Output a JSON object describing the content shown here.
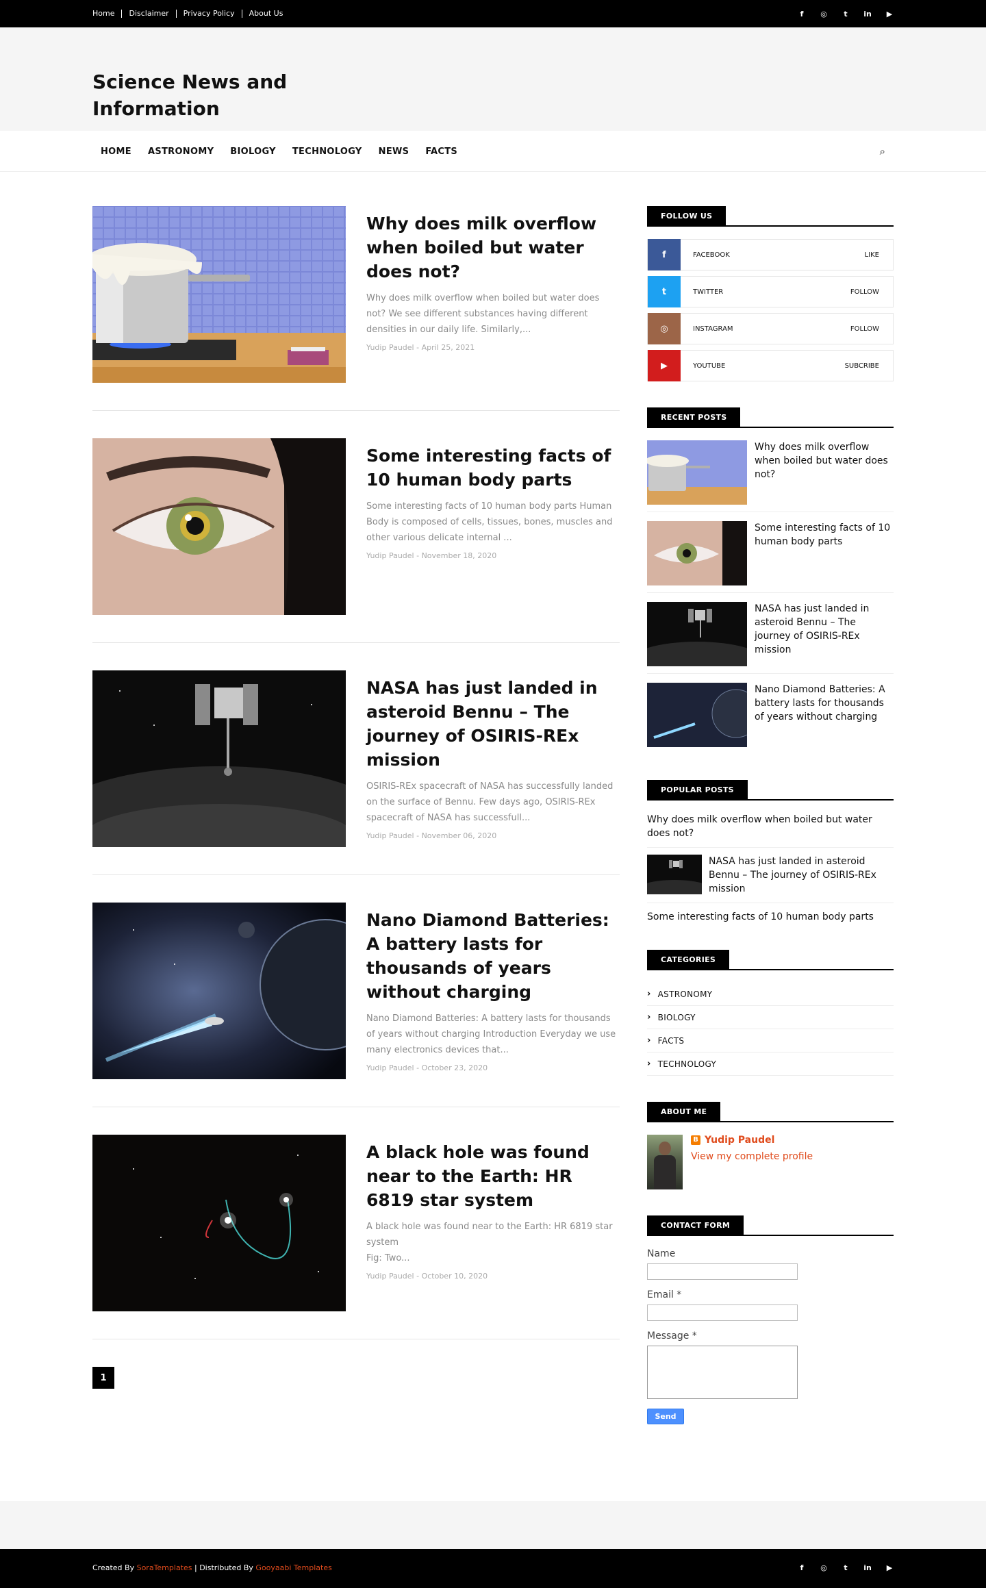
{
  "topbar": {
    "links": [
      "Home",
      "Disclaimer",
      "Privacy Policy",
      "About Us"
    ],
    "social": [
      "facebook-icon",
      "instagram-icon",
      "twitter-icon",
      "linkedin-icon",
      "youtube-icon"
    ],
    "social_glyphs": [
      "f",
      "◎",
      "t",
      "in",
      "▶"
    ]
  },
  "header": {
    "title": "Science News and Information"
  },
  "nav": {
    "items": [
      "HOME",
      "ASTRONOMY",
      "BIOLOGY",
      "TECHNOLOGY",
      "NEWS",
      "FACTS"
    ],
    "search_glyph": "⌕"
  },
  "posts": [
    {
      "title": "Why does milk overflow when boiled but water does not?",
      "snippet": "Why does milk overflow when boiled but water does not?  We see different substances having different densities in our daily life. Similarly,...",
      "meta": "Yudip Paudel - April 25, 2021"
    },
    {
      "title": "Some interesting facts of 10 human body parts",
      "snippet": " Some interesting facts of 10 human body parts Human Body is composed of cells, tissues, bones, muscles and other various delicate internal ...",
      "meta": "Yudip Paudel - November 18, 2020"
    },
    {
      "title": "NASA has just landed in asteroid Bennu – The journey of OSIRIS-REx mission",
      "snippet": "OSIRIS-REx spacecraft of NASA has successfully landed on the surface of Bennu.   Few days ago, OSIRIS-REx spacecraft of NASA has successfull...",
      "meta": "Yudip Paudel - November 06, 2020"
    },
    {
      "title": "Nano Diamond Batteries: A battery lasts for thousands of years without charging",
      "snippet": "Nano Diamond Batteries: A battery lasts for thousands of years without charging Introduction Everyday we use many electronics devices that...",
      "meta": "Yudip Paudel - October 23, 2020"
    },
    {
      "title": "A black hole was found near to the Earth: HR 6819 star system",
      "snippet": "A black hole was found near to the Earth: HR 6819 star system\nFig: Two...",
      "meta": "Yudip Paudel - October 10, 2020"
    }
  ],
  "pager": {
    "current": "1"
  },
  "sidebar": {
    "follow": {
      "title": "FOLLOW US",
      "rows": [
        {
          "name": "FACEBOOK",
          "action": "LIKE",
          "glyph": "f",
          "color": "#3b5998"
        },
        {
          "name": "TWITTER",
          "action": "FOLLOW",
          "glyph": "t",
          "color": "#1da1f2"
        },
        {
          "name": "INSTAGRAM",
          "action": "FOLLOW",
          "glyph": "◎",
          "color": "#9c6548"
        },
        {
          "name": "YOUTUBE",
          "action": "SUBCRIBE",
          "glyph": "▶",
          "color": "#d21d1d"
        }
      ]
    },
    "recent": {
      "title": "RECENT POSTS",
      "items": [
        "Why does milk overflow when boiled but water does not?",
        "Some interesting facts of 10 human body parts",
        "NASA has just landed in asteroid Bennu – The journey of OSIRIS-REx mission",
        "Nano Diamond Batteries: A battery lasts for thousands of years without charging"
      ]
    },
    "popular": {
      "title": "POPULAR POSTS",
      "item1": "Why does milk overflow when boiled but water does not?",
      "item2": "NASA has just landed in asteroid Bennu – The journey of OSIRIS-REx mission",
      "item3": "Some interesting facts of 10 human body parts"
    },
    "categories": {
      "title": "CATEGORIES",
      "items": [
        "ASTRONOMY",
        "BIOLOGY",
        "FACTS",
        "TECHNOLOGY"
      ]
    },
    "about": {
      "title": "ABOUT ME",
      "name": "Yudip Paudel",
      "link": "View my complete profile"
    },
    "contact": {
      "title": "CONTACT FORM",
      "name_label": "Name",
      "email_label": "Email *",
      "message_label": "Message *",
      "send": "Send"
    }
  },
  "footer": {
    "created_by": "Created By ",
    "sora": "SoraTemplates",
    "distributed": " | Distributed By ",
    "gooyaabi": "Gooyaabi Templates"
  }
}
